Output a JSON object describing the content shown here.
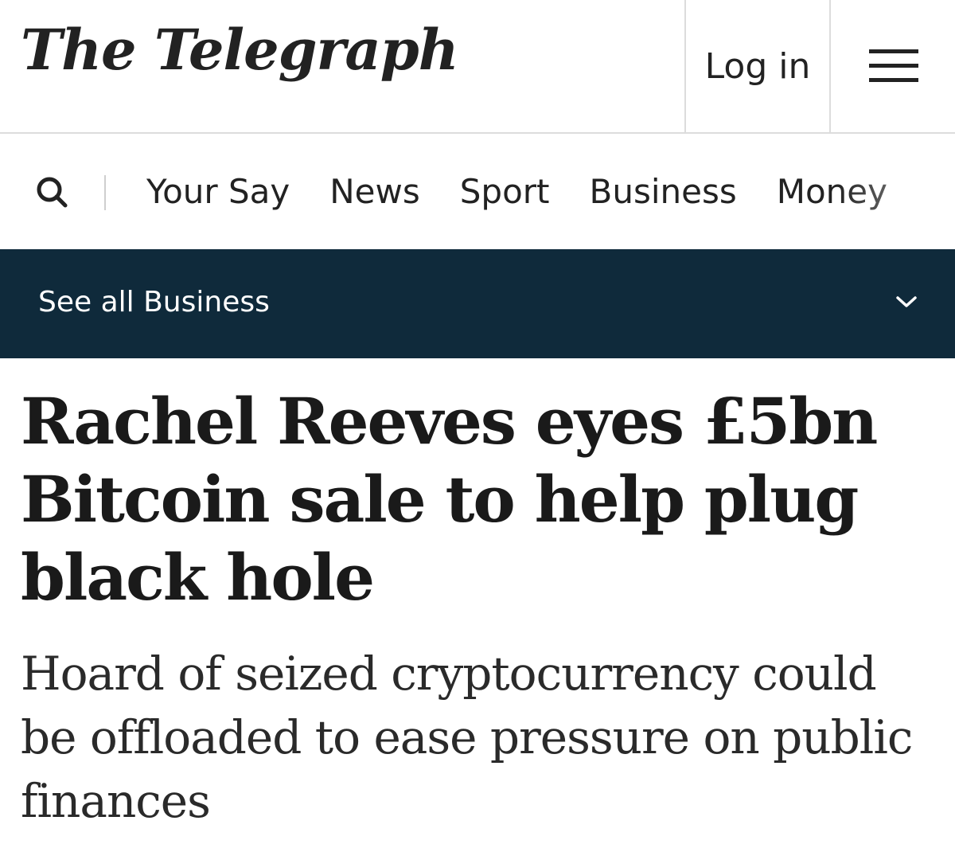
{
  "header": {
    "logo_text": "The Telegraph",
    "login_label": "Log in",
    "menu_icon": "hamburger-menu-icon"
  },
  "nav": {
    "search_icon": "search-icon",
    "items": [
      {
        "label": "Your Say"
      },
      {
        "label": "News"
      },
      {
        "label": "Sport"
      },
      {
        "label": "Business"
      },
      {
        "label": "Money"
      }
    ]
  },
  "section_bar": {
    "label": "See all Business",
    "icon": "chevron-down-icon",
    "background": "#0f2a3b"
  },
  "article": {
    "headline": "Rachel Reeves eyes £5bn Bitcoin sale to help plug black hole",
    "subheadline": "Hoard of seized cryptocurrency could be offloaded to ease pressure on public finances"
  }
}
